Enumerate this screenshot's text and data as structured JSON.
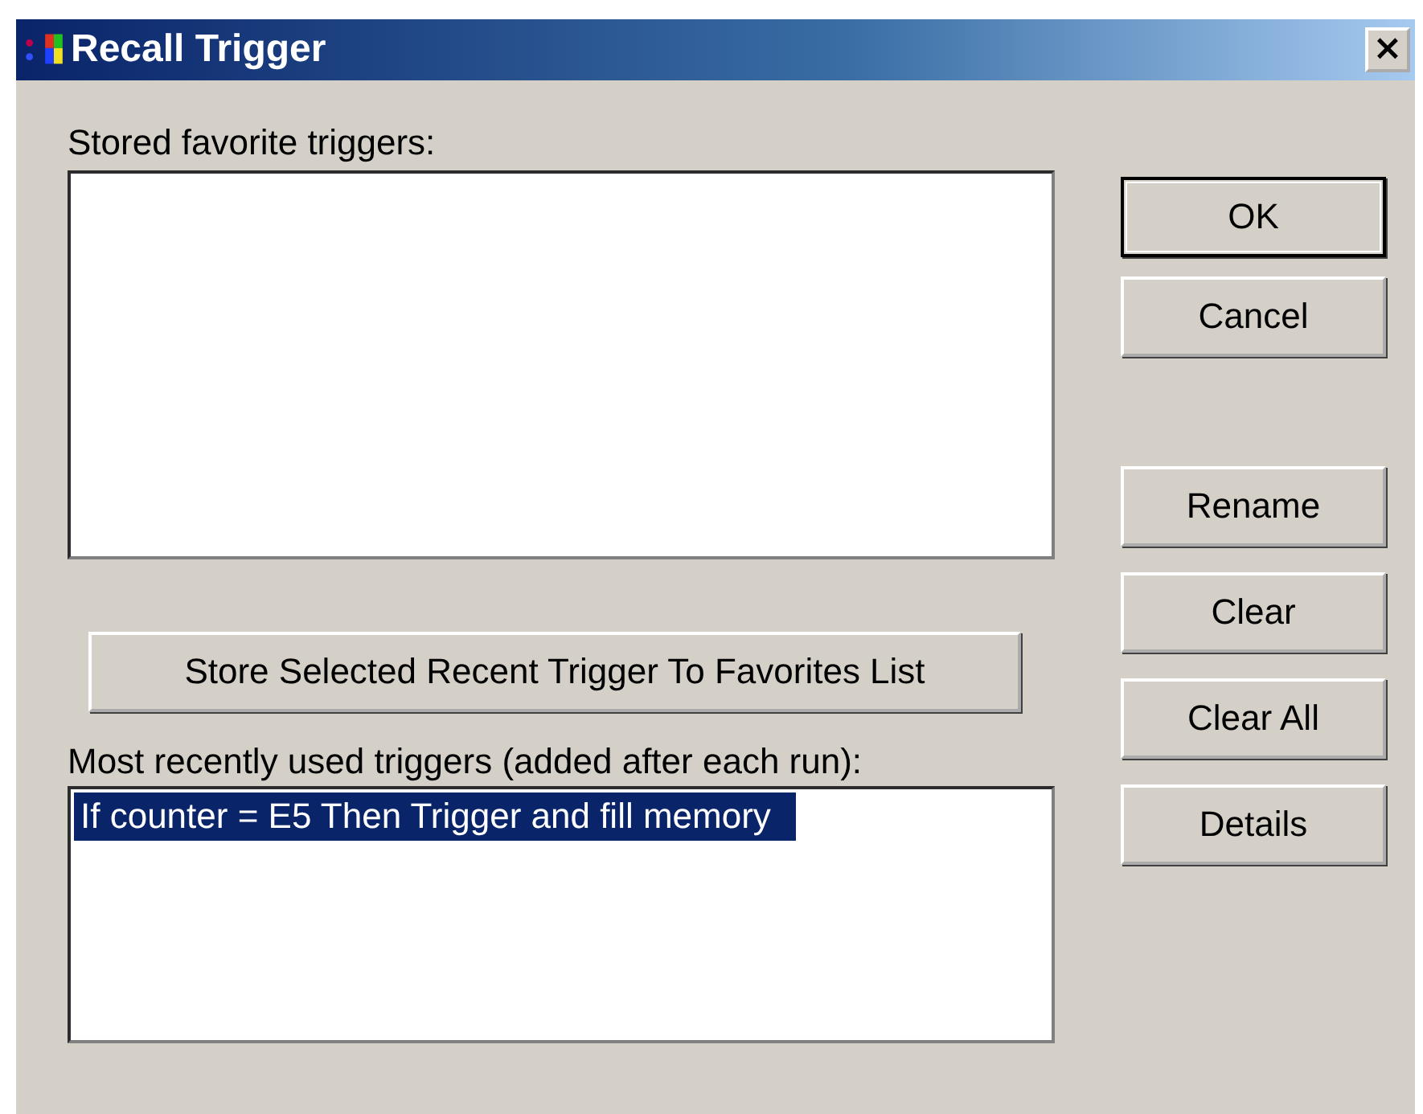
{
  "window": {
    "title": "Recall Trigger",
    "close": "×"
  },
  "favorites": {
    "label": "Stored favorite triggers:"
  },
  "store_button": "Store Selected Recent Trigger To Favorites List",
  "recent": {
    "label": "Most recently used triggers (added after each run):",
    "items": [
      {
        "text": "If counter = E5 Then Trigger and fill memory",
        "selected": true
      }
    ]
  },
  "buttons": [
    {
      "label": "OK",
      "default": true
    },
    {
      "label": "Cancel",
      "default": false
    },
    {
      "label": "Rename",
      "default": false
    },
    {
      "label": "Clear",
      "default": false
    },
    {
      "label": "Clear All",
      "default": false
    },
    {
      "label": "Details",
      "default": false
    }
  ]
}
